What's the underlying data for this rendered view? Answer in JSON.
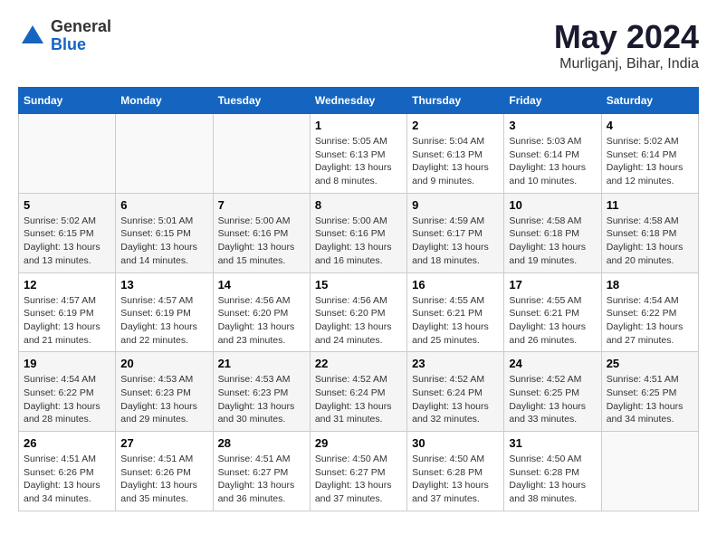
{
  "header": {
    "logo": {
      "general": "General",
      "blue": "Blue"
    },
    "title": "May 2024",
    "subtitle": "Murliganj, Bihar, India"
  },
  "days_of_week": [
    "Sunday",
    "Monday",
    "Tuesday",
    "Wednesday",
    "Thursday",
    "Friday",
    "Saturday"
  ],
  "weeks": [
    [
      {
        "day": "",
        "sunrise": "",
        "sunset": "",
        "daylight": ""
      },
      {
        "day": "",
        "sunrise": "",
        "sunset": "",
        "daylight": ""
      },
      {
        "day": "",
        "sunrise": "",
        "sunset": "",
        "daylight": ""
      },
      {
        "day": "1",
        "sunrise": "Sunrise: 5:05 AM",
        "sunset": "Sunset: 6:13 PM",
        "daylight": "Daylight: 13 hours and 8 minutes."
      },
      {
        "day": "2",
        "sunrise": "Sunrise: 5:04 AM",
        "sunset": "Sunset: 6:13 PM",
        "daylight": "Daylight: 13 hours and 9 minutes."
      },
      {
        "day": "3",
        "sunrise": "Sunrise: 5:03 AM",
        "sunset": "Sunset: 6:14 PM",
        "daylight": "Daylight: 13 hours and 10 minutes."
      },
      {
        "day": "4",
        "sunrise": "Sunrise: 5:02 AM",
        "sunset": "Sunset: 6:14 PM",
        "daylight": "Daylight: 13 hours and 12 minutes."
      }
    ],
    [
      {
        "day": "5",
        "sunrise": "Sunrise: 5:02 AM",
        "sunset": "Sunset: 6:15 PM",
        "daylight": "Daylight: 13 hours and 13 minutes."
      },
      {
        "day": "6",
        "sunrise": "Sunrise: 5:01 AM",
        "sunset": "Sunset: 6:15 PM",
        "daylight": "Daylight: 13 hours and 14 minutes."
      },
      {
        "day": "7",
        "sunrise": "Sunrise: 5:00 AM",
        "sunset": "Sunset: 6:16 PM",
        "daylight": "Daylight: 13 hours and 15 minutes."
      },
      {
        "day": "8",
        "sunrise": "Sunrise: 5:00 AM",
        "sunset": "Sunset: 6:16 PM",
        "daylight": "Daylight: 13 hours and 16 minutes."
      },
      {
        "day": "9",
        "sunrise": "Sunrise: 4:59 AM",
        "sunset": "Sunset: 6:17 PM",
        "daylight": "Daylight: 13 hours and 18 minutes."
      },
      {
        "day": "10",
        "sunrise": "Sunrise: 4:58 AM",
        "sunset": "Sunset: 6:18 PM",
        "daylight": "Daylight: 13 hours and 19 minutes."
      },
      {
        "day": "11",
        "sunrise": "Sunrise: 4:58 AM",
        "sunset": "Sunset: 6:18 PM",
        "daylight": "Daylight: 13 hours and 20 minutes."
      }
    ],
    [
      {
        "day": "12",
        "sunrise": "Sunrise: 4:57 AM",
        "sunset": "Sunset: 6:19 PM",
        "daylight": "Daylight: 13 hours and 21 minutes."
      },
      {
        "day": "13",
        "sunrise": "Sunrise: 4:57 AM",
        "sunset": "Sunset: 6:19 PM",
        "daylight": "Daylight: 13 hours and 22 minutes."
      },
      {
        "day": "14",
        "sunrise": "Sunrise: 4:56 AM",
        "sunset": "Sunset: 6:20 PM",
        "daylight": "Daylight: 13 hours and 23 minutes."
      },
      {
        "day": "15",
        "sunrise": "Sunrise: 4:56 AM",
        "sunset": "Sunset: 6:20 PM",
        "daylight": "Daylight: 13 hours and 24 minutes."
      },
      {
        "day": "16",
        "sunrise": "Sunrise: 4:55 AM",
        "sunset": "Sunset: 6:21 PM",
        "daylight": "Daylight: 13 hours and 25 minutes."
      },
      {
        "day": "17",
        "sunrise": "Sunrise: 4:55 AM",
        "sunset": "Sunset: 6:21 PM",
        "daylight": "Daylight: 13 hours and 26 minutes."
      },
      {
        "day": "18",
        "sunrise": "Sunrise: 4:54 AM",
        "sunset": "Sunset: 6:22 PM",
        "daylight": "Daylight: 13 hours and 27 minutes."
      }
    ],
    [
      {
        "day": "19",
        "sunrise": "Sunrise: 4:54 AM",
        "sunset": "Sunset: 6:22 PM",
        "daylight": "Daylight: 13 hours and 28 minutes."
      },
      {
        "day": "20",
        "sunrise": "Sunrise: 4:53 AM",
        "sunset": "Sunset: 6:23 PM",
        "daylight": "Daylight: 13 hours and 29 minutes."
      },
      {
        "day": "21",
        "sunrise": "Sunrise: 4:53 AM",
        "sunset": "Sunset: 6:23 PM",
        "daylight": "Daylight: 13 hours and 30 minutes."
      },
      {
        "day": "22",
        "sunrise": "Sunrise: 4:52 AM",
        "sunset": "Sunset: 6:24 PM",
        "daylight": "Daylight: 13 hours and 31 minutes."
      },
      {
        "day": "23",
        "sunrise": "Sunrise: 4:52 AM",
        "sunset": "Sunset: 6:24 PM",
        "daylight": "Daylight: 13 hours and 32 minutes."
      },
      {
        "day": "24",
        "sunrise": "Sunrise: 4:52 AM",
        "sunset": "Sunset: 6:25 PM",
        "daylight": "Daylight: 13 hours and 33 minutes."
      },
      {
        "day": "25",
        "sunrise": "Sunrise: 4:51 AM",
        "sunset": "Sunset: 6:25 PM",
        "daylight": "Daylight: 13 hours and 34 minutes."
      }
    ],
    [
      {
        "day": "26",
        "sunrise": "Sunrise: 4:51 AM",
        "sunset": "Sunset: 6:26 PM",
        "daylight": "Daylight: 13 hours and 34 minutes."
      },
      {
        "day": "27",
        "sunrise": "Sunrise: 4:51 AM",
        "sunset": "Sunset: 6:26 PM",
        "daylight": "Daylight: 13 hours and 35 minutes."
      },
      {
        "day": "28",
        "sunrise": "Sunrise: 4:51 AM",
        "sunset": "Sunset: 6:27 PM",
        "daylight": "Daylight: 13 hours and 36 minutes."
      },
      {
        "day": "29",
        "sunrise": "Sunrise: 4:50 AM",
        "sunset": "Sunset: 6:27 PM",
        "daylight": "Daylight: 13 hours and 37 minutes."
      },
      {
        "day": "30",
        "sunrise": "Sunrise: 4:50 AM",
        "sunset": "Sunset: 6:28 PM",
        "daylight": "Daylight: 13 hours and 37 minutes."
      },
      {
        "day": "31",
        "sunrise": "Sunrise: 4:50 AM",
        "sunset": "Sunset: 6:28 PM",
        "daylight": "Daylight: 13 hours and 38 minutes."
      },
      {
        "day": "",
        "sunrise": "",
        "sunset": "",
        "daylight": ""
      }
    ]
  ]
}
